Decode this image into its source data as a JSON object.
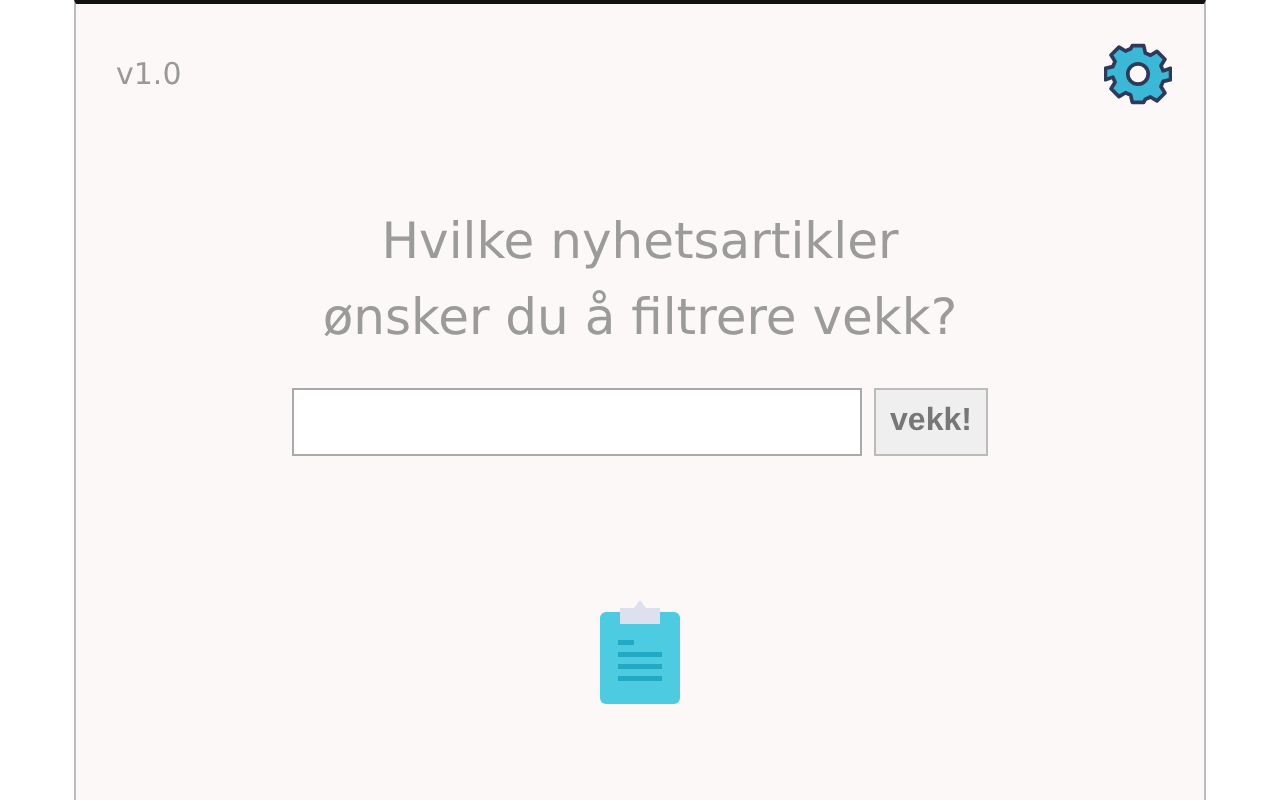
{
  "version": "v1.0",
  "heading": [
    "Hvilke nyhetsartikler",
    "ønsker du å filtrere vekk?"
  ],
  "submit_button": {
    "label": "vekk!"
  }
}
